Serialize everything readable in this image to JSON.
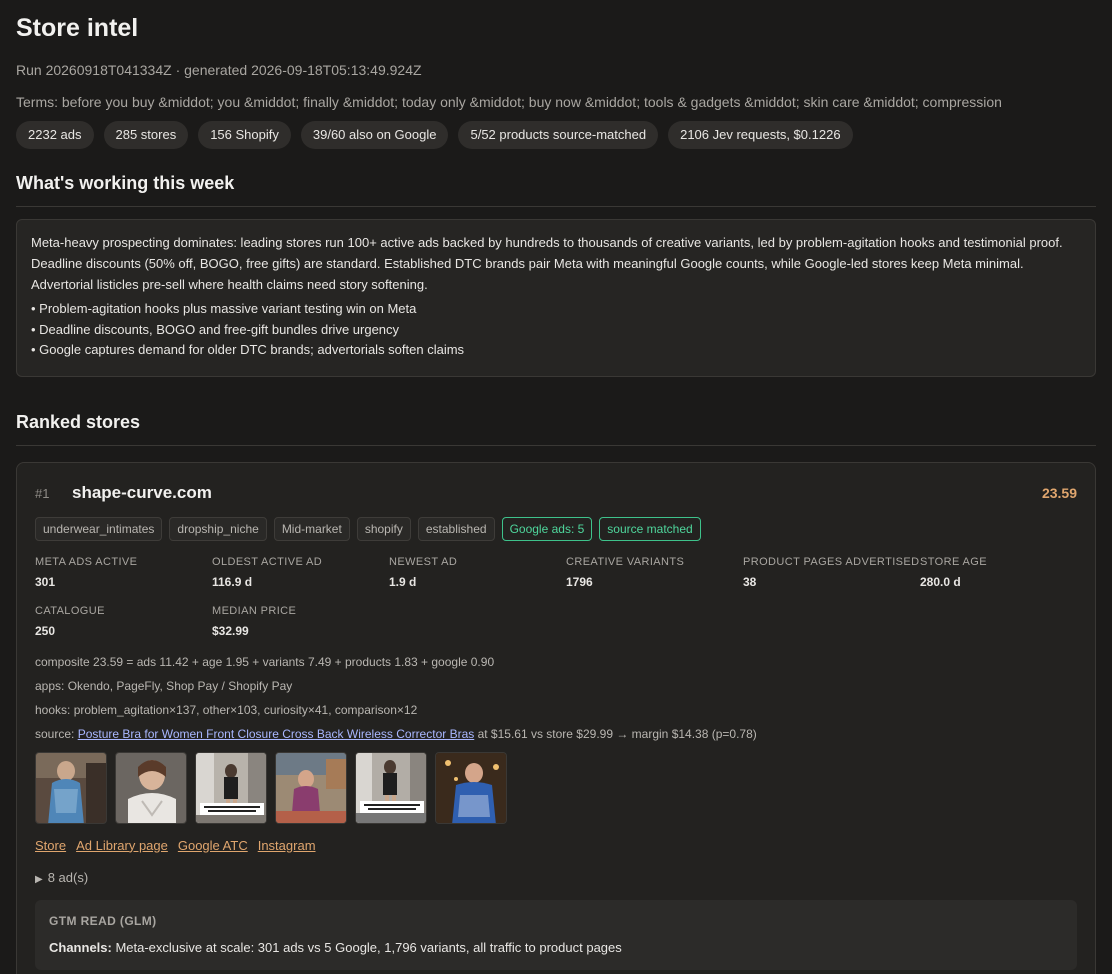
{
  "header": {
    "title": "Store intel",
    "run": "Run 20260918T041334Z · generated 2026-09-18T05:13:49.924Z",
    "terms": "Terms: before you buy &middot; you &middot; finally &middot; today only &middot; buy now &middot; tools & gadgets &middot; skin care &middot; compression"
  },
  "pills": [
    "2232 ads",
    "285 stores",
    "156 Shopify",
    "39/60 also on Google",
    "5/52 products source-matched",
    "2106 Jev requests, $0.1226"
  ],
  "working": {
    "title": "What's working this week",
    "summary": "Meta-heavy prospecting dominates: leading stores run 100+ active ads backed by hundreds to thousands of creative variants, led by problem-agitation hooks and testimonial proof. Deadline discounts (50% off, BOGO, free gifts) are standard. Established DTC brands pair Meta with meaningful Google counts, while Google-led stores keep Meta minimal. Advertorial listicles pre-sell where health claims need story softening.",
    "bullets": [
      "Problem-agitation hooks plus massive variant testing win on Meta",
      "Deadline discounts, BOGO and free-gift bundles drive urgency",
      "Google captures demand for older DTC brands; advertorials soften claims"
    ]
  },
  "ranked": {
    "title": "Ranked stores",
    "store": {
      "rank": "#1",
      "domain": "shape-curve.com",
      "score": "23.59",
      "tags": [
        "underwear_intimates",
        "dropship_niche",
        "Mid-market",
        "shopify",
        "established"
      ],
      "green_tags": [
        "Google ads: 5",
        "source matched"
      ],
      "stats": [
        {
          "label": "Meta ads active",
          "value": "301"
        },
        {
          "label": "Oldest active ad",
          "value": "116.9 d"
        },
        {
          "label": "Newest ad",
          "value": "1.9 d"
        },
        {
          "label": "Creative variants",
          "value": "1796"
        },
        {
          "label": "Product pages advertised",
          "value": "38"
        },
        {
          "label": "Store age",
          "value": "280.0 d"
        },
        {
          "label": "Catalogue",
          "value": "250"
        },
        {
          "label": "Median price",
          "value": "$32.99"
        }
      ],
      "composite": "composite 23.59 = ads 11.42 + age 1.95 + variants 7.49 + products 1.83 + google 0.90",
      "apps": "apps: Okendo, PageFly, Shop Pay / Shopify Pay",
      "hooks": "hooks: problem_agitation×137, other×103, curiosity×41, comparison×12",
      "source_prefix": "source: ",
      "source_link": "Posture Bra for Women Front Closure Cross Back Wireless Corrector Bras",
      "source_suffix": " at $15.61 vs store $29.99 → margin $14.38 (p=0.78)",
      "links": [
        "Store",
        "Ad Library page",
        "Google ATC",
        "Instagram"
      ],
      "ads_toggle": "8 ad(s)",
      "gtm_title": "GTM READ (GLM)",
      "gtm_label": "Channels:",
      "gtm_text": " Meta-exclusive at scale: 301 ads vs 5 Google, 1,796 variants, all traffic to product pages"
    }
  }
}
